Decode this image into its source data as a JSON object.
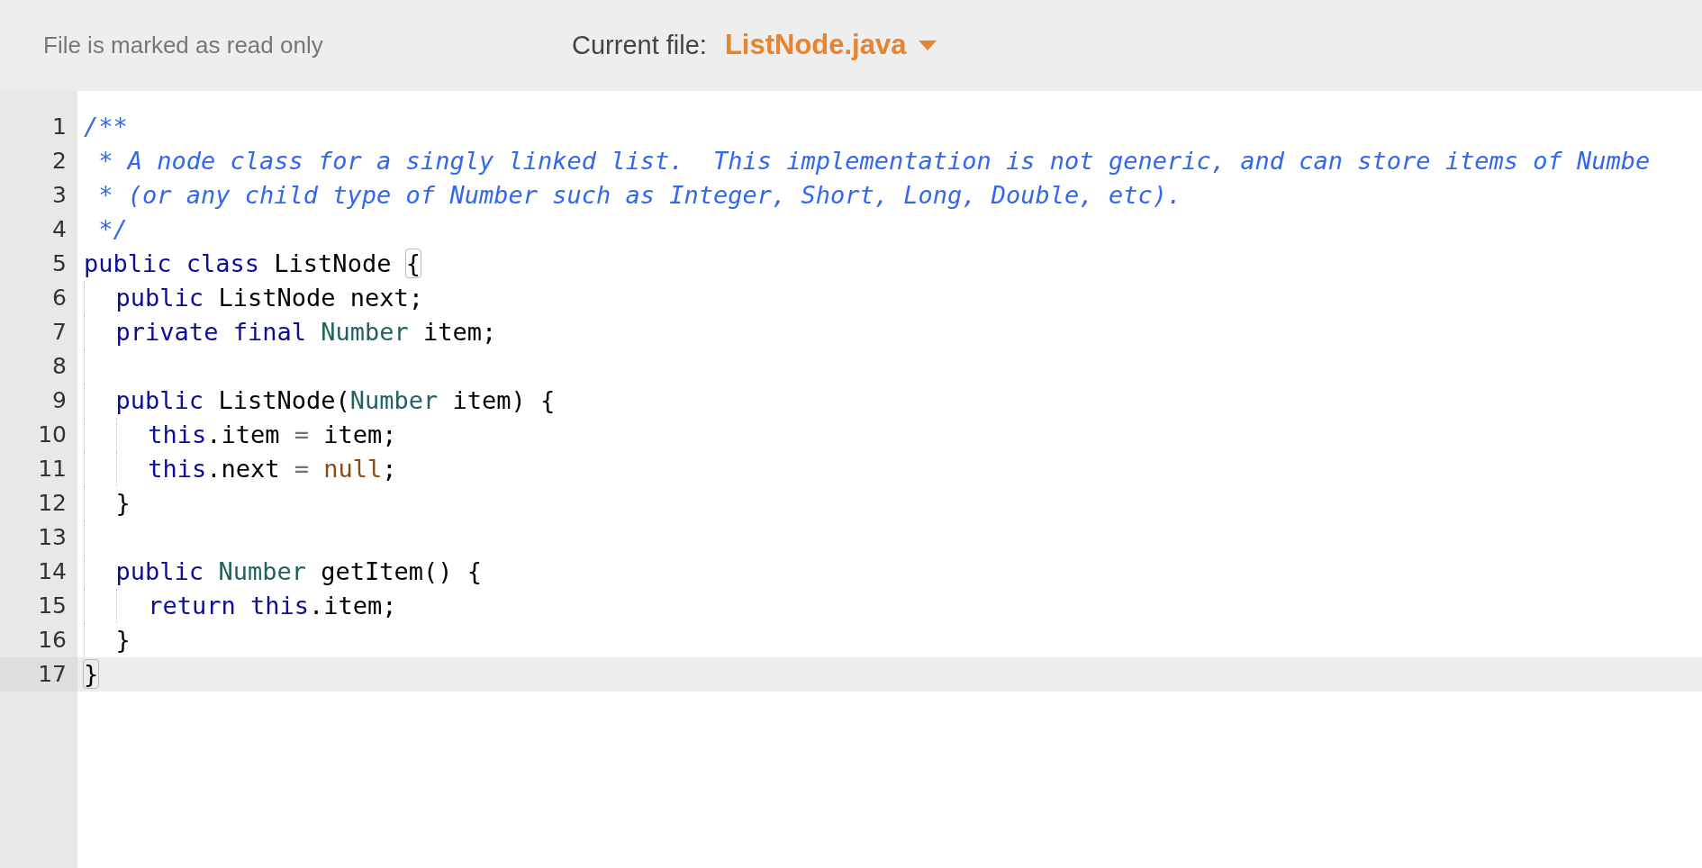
{
  "header": {
    "status": "File is marked as read only",
    "file_label": "Current file:",
    "file_name": "ListNode.java"
  },
  "lines": [
    {
      "number": "1",
      "current": false,
      "tokens": [
        {
          "kind": "comment",
          "text": "/**"
        }
      ]
    },
    {
      "number": "2",
      "current": false,
      "tokens": [
        {
          "kind": "comment",
          "text": " * A node class for a singly linked list.  This implementation is not generic, and can store items of Numbe"
        }
      ]
    },
    {
      "number": "3",
      "current": false,
      "tokens": [
        {
          "kind": "comment",
          "text": " * (or any child type of Number such as Integer, Short, Long, Double, etc)."
        }
      ]
    },
    {
      "number": "4",
      "current": false,
      "tokens": [
        {
          "kind": "comment",
          "text": " */"
        }
      ]
    },
    {
      "number": "5",
      "current": false,
      "tokens": [
        {
          "kind": "keyword",
          "text": "public"
        },
        {
          "kind": "keyword",
          "text": " class"
        },
        {
          "kind": "plain",
          "text": " ListNode "
        },
        {
          "kind": "brace_match",
          "text": "{"
        }
      ],
      "children": [
        {
          "number": "6",
          "current": false,
          "tokens": [
            {
              "kind": "keyword",
              "text": "public"
            },
            {
              "kind": "plain",
              "text": " ListNode next;"
            }
          ]
        },
        {
          "number": "7",
          "current": false,
          "tokens": [
            {
              "kind": "keyword",
              "text": "private"
            },
            {
              "kind": "keyword",
              "text": " final"
            },
            {
              "kind": "type",
              "text": " Number"
            },
            {
              "kind": "plain",
              "text": " item;"
            }
          ]
        },
        {
          "number": "8",
          "current": false
        },
        {
          "number": "9",
          "current": false,
          "tokens": [
            {
              "kind": "keyword",
              "text": "public"
            },
            {
              "kind": "plain",
              "text": " ListNode("
            },
            {
              "kind": "type",
              "text": "Number"
            },
            {
              "kind": "plain",
              "text": " item) {"
            }
          ],
          "children": [
            {
              "number": "10",
              "current": false,
              "tokens": [
                {
                  "kind": "keyword",
                  "text": "this"
                },
                {
                  "kind": "plain",
                  "text": ".item "
                },
                {
                  "kind": "operator",
                  "text": "="
                },
                {
                  "kind": "plain",
                  "text": " item;"
                }
              ]
            },
            {
              "number": "11",
              "current": false,
              "tokens": [
                {
                  "kind": "keyword",
                  "text": "this"
                },
                {
                  "kind": "plain",
                  "text": ".next "
                },
                {
                  "kind": "operator",
                  "text": "="
                },
                {
                  "kind": "literal",
                  "text": " null"
                },
                {
                  "kind": "plain",
                  "text": ";"
                }
              ]
            }
          ]
        },
        {
          "number": "12",
          "current": false,
          "tokens": [
            {
              "kind": "plain",
              "text": "}"
            }
          ]
        },
        {
          "number": "13",
          "current": false
        },
        {
          "number": "14",
          "current": false,
          "tokens": [
            {
              "kind": "keyword",
              "text": "public"
            },
            {
              "kind": "type",
              "text": " Number"
            },
            {
              "kind": "plain",
              "text": " getItem() {"
            }
          ],
          "children": [
            {
              "number": "15",
              "current": false,
              "tokens": [
                {
                  "kind": "keyword",
                  "text": "return"
                },
                {
                  "kind": "keyword",
                  "text": " this"
                },
                {
                  "kind": "plain",
                  "text": ".item;"
                }
              ]
            }
          ]
        },
        {
          "number": "16",
          "current": false,
          "tokens": [
            {
              "kind": "plain",
              "text": "}"
            }
          ]
        }
      ]
    },
    {
      "number": "17",
      "current": true,
      "tokens": [
        {
          "kind": "brace_match",
          "text": "}"
        }
      ]
    }
  ]
}
